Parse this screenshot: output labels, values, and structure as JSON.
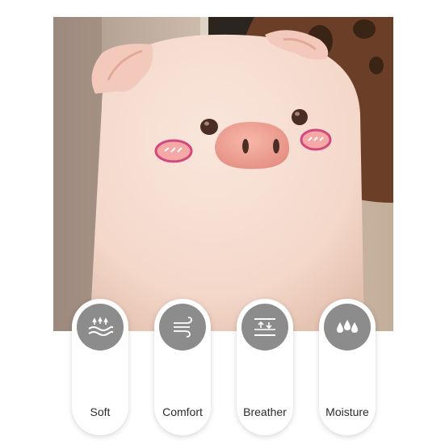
{
  "photo": {
    "subject": "pink pig plush pillow",
    "colors": {
      "plush": "#f7ddd0",
      "nose": "#f2a899",
      "cheek": "#d1497e",
      "wall": "#cdbba9",
      "frame": "#6b3f27"
    }
  },
  "features": {
    "icon_background": "#8c8c8c",
    "items": [
      {
        "label": "Soft",
        "icon": "soft-waves-icon"
      },
      {
        "label": "Comfort",
        "icon": "wind-icon"
      },
      {
        "label": "Breather",
        "icon": "breathable-arrows-icon"
      },
      {
        "label": "Moisture",
        "icon": "water-drops-icon"
      }
    ]
  }
}
